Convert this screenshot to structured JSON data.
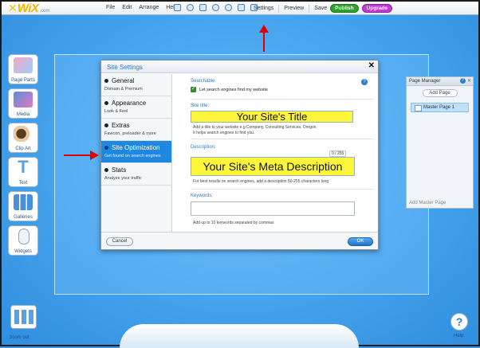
{
  "app": {
    "logo": "WiX",
    "logo_suffix": ".com"
  },
  "topbar": {
    "menu": [
      "File",
      "Edit",
      "Arrange",
      "Help"
    ],
    "settings": "Settings",
    "preview": "Preview",
    "save": "Save",
    "publish": "Publish",
    "upgrade": "Upgrade"
  },
  "left_panel": {
    "items": [
      {
        "label": "Page Parts",
        "icon": "page-parts-icon"
      },
      {
        "label": "Media",
        "icon": "media-icon"
      },
      {
        "label": "Clip Art",
        "icon": "clip-art-icon"
      },
      {
        "label": "Text",
        "icon": "text-icon"
      },
      {
        "label": "Galleries",
        "icon": "galleries-icon"
      },
      {
        "label": "Widgets",
        "icon": "widgets-icon"
      }
    ],
    "bottom_label": "zoom out"
  },
  "page_manager": {
    "title": "Page Manager",
    "add_page": "Add Page",
    "pages": [
      "Master Page 1"
    ],
    "add_master": "Add Master Page"
  },
  "dialog": {
    "title": "Site Settings",
    "nav": [
      {
        "title": "General",
        "sub": "Domain & Premium"
      },
      {
        "title": "Appearance",
        "sub": "Look & Feel"
      },
      {
        "title": "Extras",
        "sub": "Favicon, preloader & more"
      },
      {
        "title": "Site Optimization",
        "sub": "Get found on search engines"
      },
      {
        "title": "Stats",
        "sub": "Analyze your traffic"
      }
    ],
    "active_nav": 3,
    "searchable_label": "Searchable:",
    "searchable_text": "Let search engines find my website",
    "site_title_label": "Site title:",
    "site_title_value": "Your Site's Title",
    "site_title_hint1": "Add a title to your website e.g Company, Consulting Services, Oregon.",
    "site_title_hint2": "It helps search engines to find you.",
    "description_label": "Description:",
    "description_counter": "0 / 255",
    "description_value": "Your Site's Meta Description",
    "description_hint": "For best results on search engines, add a description 50-255 characters long",
    "keywords_label": "Keywords:",
    "keywords_value": "",
    "keywords_hint": "Add up to 10 keywords separated by commas",
    "cancel": "Cancel",
    "ok": "OK"
  },
  "help_label": "Help",
  "colors": {
    "accent": "#1e87e0",
    "highlight": "#fdf63a",
    "arrow": "#e00000",
    "publish": "#2fa12c",
    "upgrade": "#c13ad0"
  }
}
